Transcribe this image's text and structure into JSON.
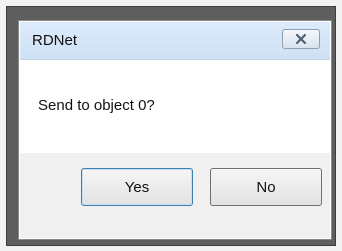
{
  "dialog": {
    "title": "RDNet",
    "close_icon": "close-icon",
    "message": "Send to object 0?",
    "buttons": {
      "yes_label": "Yes",
      "no_label": "No"
    }
  }
}
